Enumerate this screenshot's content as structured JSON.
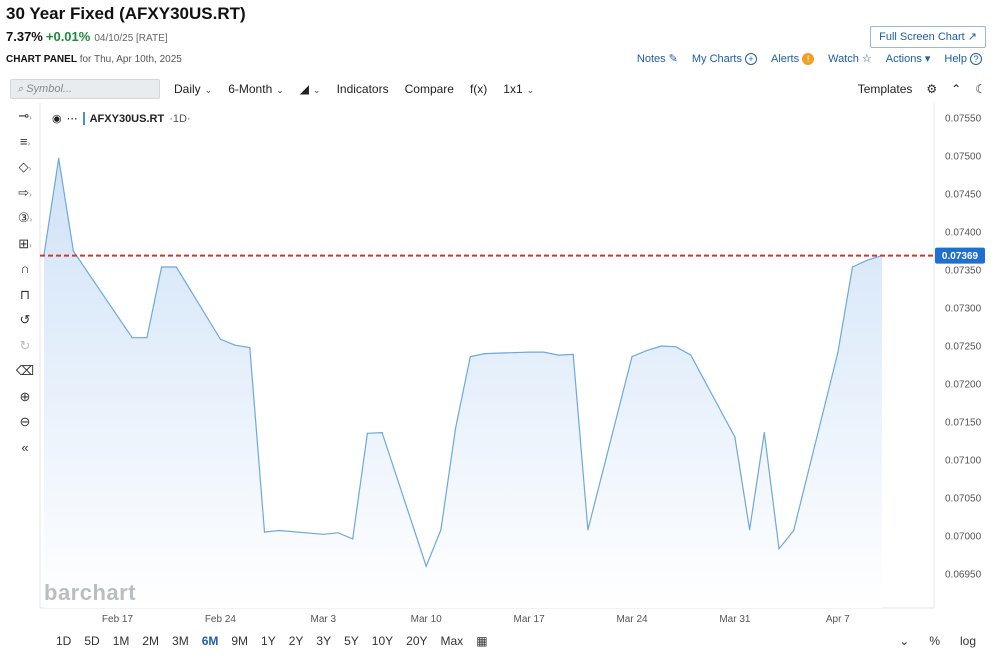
{
  "header": {
    "title": "30 Year Fixed (AFXY30US.RT)",
    "last": "7.37%",
    "change": "+0.01%",
    "date": "04/10/25 [RATE]",
    "full_screen": "Full Screen Chart ↗",
    "panel_label": "CHART PANEL",
    "panel_date": "for Thu, Apr 10th, 2025",
    "links": {
      "notes": "Notes",
      "my_charts": "My Charts",
      "alerts": "Alerts",
      "watch": "Watch",
      "actions": "Actions",
      "help": "Help"
    }
  },
  "toolbar": {
    "symbol_placeholder": "Symbol...",
    "interval": "Daily",
    "period": "6-Month",
    "indicators": "Indicators",
    "compare": "Compare",
    "fx": "f(x)",
    "layout": "1x1",
    "templates": "Templates"
  },
  "legend": {
    "symbol": "AFXY30US.RT",
    "timeframe": "·1D·"
  },
  "watermark": "barchart",
  "ranges": [
    "1D",
    "5D",
    "1M",
    "2M",
    "3M",
    "6M",
    "9M",
    "1Y",
    "2Y",
    "3Y",
    "5Y",
    "10Y",
    "20Y",
    "Max"
  ],
  "active_range": "6M",
  "bottom_right": {
    "percent": "%",
    "log": "log"
  },
  "colors": {
    "line": "#6fa8dc",
    "fill_top": "#cfe2f7",
    "fill_bottom": "#ffffff",
    "ref_line": "#d9342b",
    "price_label": "#1f6fd1"
  },
  "chart_data": {
    "type": "area",
    "x": [
      "2025-02-12",
      "2025-02-13",
      "2025-02-14",
      "2025-02-18",
      "2025-02-19",
      "2025-02-20",
      "2025-02-21",
      "2025-02-24",
      "2025-02-25",
      "2025-02-26",
      "2025-02-27",
      "2025-02-28",
      "2025-03-03",
      "2025-03-04",
      "2025-03-05",
      "2025-03-06",
      "2025-03-07",
      "2025-03-10",
      "2025-03-11",
      "2025-03-12",
      "2025-03-13",
      "2025-03-14",
      "2025-03-17",
      "2025-03-18",
      "2025-03-19",
      "2025-03-20",
      "2025-03-21",
      "2025-03-24",
      "2025-03-25",
      "2025-03-26",
      "2025-03-27",
      "2025-03-28",
      "2025-03-31",
      "2025-04-01",
      "2025-04-02",
      "2025-04-03",
      "2025-04-04",
      "2025-04-07",
      "2025-04-08",
      "2025-04-09",
      "2025-04-10"
    ],
    "series": [
      {
        "values": [
          0.0737,
          0.07497,
          0.07375,
          0.07261,
          0.07261,
          0.07354,
          0.07354,
          0.07259,
          0.07251,
          0.07248,
          0.07005,
          0.07007,
          0.07002,
          0.07004,
          0.06996,
          0.07135,
          0.07136,
          0.0696,
          0.07008,
          0.07142,
          0.07236,
          0.0724,
          0.07242,
          0.07242,
          0.07238,
          0.07239,
          0.07008,
          0.07236,
          0.07244,
          0.0725,
          0.07249,
          0.07238,
          0.0713,
          0.07008,
          0.07136,
          0.06983,
          0.07007,
          0.07241,
          0.07354,
          0.07363,
          0.07369
        ]
      }
    ],
    "x_ticks": [
      "Feb 17",
      "Feb 24",
      "Mar 3",
      "Mar 10",
      "Mar 17",
      "Mar 24",
      "Mar 31",
      "Apr 7"
    ],
    "y_ticks": [
      "0.06950",
      "0.07000",
      "0.07050",
      "0.07100",
      "0.07150",
      "0.07200",
      "0.07250",
      "0.07300",
      "0.07350",
      "0.07400",
      "0.07450",
      "0.07500",
      "0.07550"
    ],
    "ylim": [
      0.06905,
      0.0757
    ],
    "last_value": "0.07369",
    "reference_line": 0.07369
  }
}
